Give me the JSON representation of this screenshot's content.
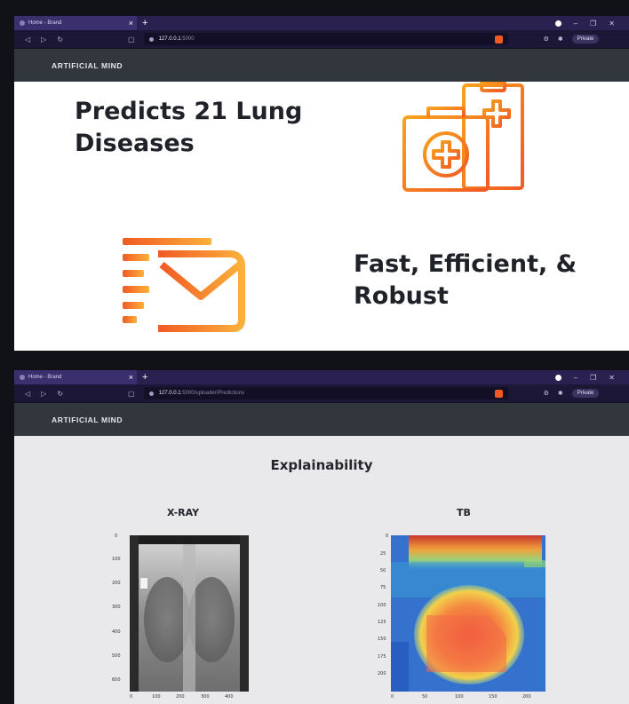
{
  "screenshot_a": {
    "tab_title": "Home - Brand",
    "url_host": "127.0.0.1",
    "url_path": ":5000",
    "private_label": "Private",
    "brand": "ARTIFICIAL MIND",
    "feature_1": "Predicts 21 Lung Diseases",
    "feature_1_line1": "Predicts 21 Lung",
    "feature_1_line2": "Diseases",
    "feature_2_line1": "Fast, Efficient, &",
    "feature_2_line2": "Robust",
    "icons": [
      "medical-kit-clipboard-icon",
      "fast-mail-icon"
    ],
    "icon_gradient": [
      "#f7941d",
      "#f15a24"
    ]
  },
  "screenshot_b": {
    "tab_title": "Home - Brand",
    "url_host": "127.0.0.1",
    "url_path": ":5000/uploader/Predictions",
    "private_label": "Private",
    "brand": "ARTIFICIAL MIND",
    "section_title": "Explainability",
    "xray": {
      "title": "X-RAY",
      "y_ticks": [
        "0",
        "100",
        "200",
        "300",
        "400",
        "500",
        "600"
      ],
      "x_ticks": [
        "0",
        "100",
        "200",
        "300",
        "400"
      ]
    },
    "tb": {
      "title": "TB",
      "y_ticks": [
        "0",
        "25",
        "50",
        "75",
        "100",
        "125",
        "150",
        "175",
        "200"
      ],
      "x_ticks": [
        "0",
        "50",
        "100",
        "150",
        "200"
      ]
    }
  }
}
